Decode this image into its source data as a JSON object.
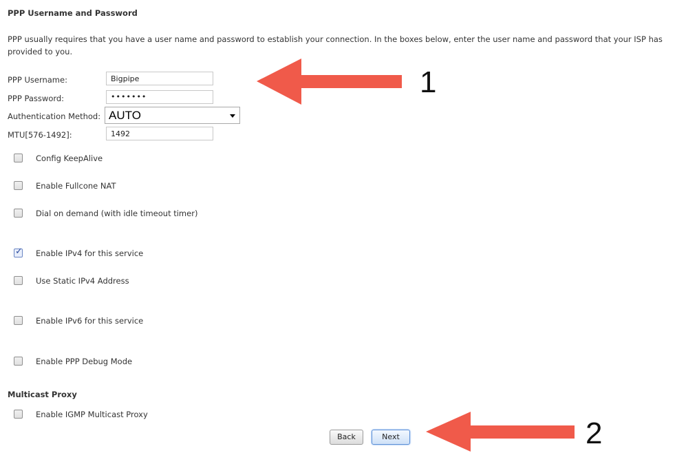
{
  "header": {
    "title": "PPP Username and Password"
  },
  "description": "PPP usually requires that you have a user name and password to establish your connection. In the boxes below, enter the user name and password that your ISP has provided to you.",
  "fields": {
    "username_label": "PPP Username:",
    "username_value": "Bigpipe",
    "password_label": "PPP Password:",
    "password_value": "•••••••",
    "auth_label": "Authentication Method:",
    "auth_value": "AUTO",
    "mtu_label": "MTU[576-1492]:",
    "mtu_value": "1492"
  },
  "options": [
    {
      "label": "Config KeepAlive",
      "checked": false
    },
    {
      "label": "Enable Fullcone NAT",
      "checked": false
    },
    {
      "label": "Dial on demand (with idle timeout timer)",
      "checked": false
    },
    {
      "label": "Enable IPv4 for this service",
      "checked": true
    },
    {
      "label": "Use Static IPv4 Address",
      "checked": false
    },
    {
      "label": "Enable IPv6 for this service",
      "checked": false
    },
    {
      "label": "Enable PPP Debug Mode",
      "checked": false
    }
  ],
  "multicast": {
    "title": "Multicast Proxy",
    "option_label": "Enable IGMP Multicast Proxy",
    "checked": false
  },
  "buttons": {
    "back": "Back",
    "next": "Next"
  },
  "annotations": {
    "arrow1_number": "1",
    "arrow2_number": "2",
    "arrow_color": "#f05a4a"
  }
}
